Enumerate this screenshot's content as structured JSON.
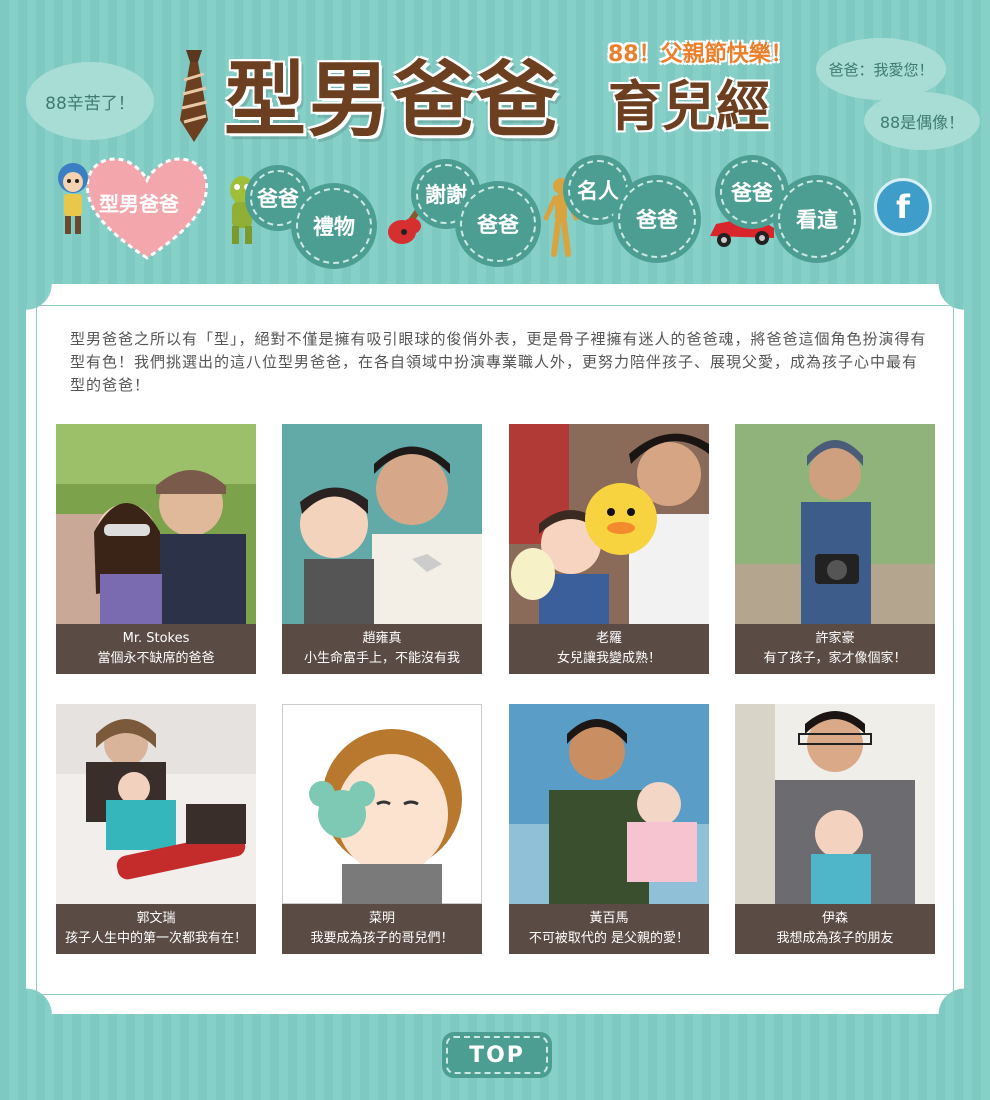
{
  "header": {
    "bubble_left": "88辛苦了！",
    "bubble_right_1": "爸爸：我愛您！",
    "bubble_right_2": "88是偶像！",
    "title_tagline": "88！父親節快樂！",
    "title_main": "型男爸爸",
    "title_sub": "育兒經",
    "colors": {
      "title": "#6b3f1f",
      "tagline": "#ec7f2c",
      "background": "#7ecac2"
    }
  },
  "nav": {
    "items": [
      {
        "label": "型男爸爸",
        "icon": "doll-figure-icon"
      },
      {
        "label_top": "爸爸",
        "label_bottom": "禮物",
        "icon": "green-toy-icon"
      },
      {
        "label_top": "謝謝",
        "label_bottom": "爸爸",
        "icon": "guitar-icon"
      },
      {
        "label_top": "名人",
        "label_bottom": "爸爸",
        "icon": "wooden-mannequin-icon"
      },
      {
        "label_top": "爸爸",
        "label_bottom": "看這",
        "icon": "red-car-icon"
      }
    ],
    "facebook": "f"
  },
  "intro": "型男爸爸之所以有「型」，絕對不僅是擁有吸引眼球的俊俏外表，更是骨子裡擁有迷人的爸爸魂，將爸爸這個角色扮演得有型有色！我們挑選出的這八位型男爸爸，在各自領域中扮演專業職人外，更努力陪伴孩子、展現父愛，成為孩子心中最有型的爸爸！",
  "dads": [
    {
      "name": "Mr. Stokes",
      "quote": "當個永不缺席的爸爸"
    },
    {
      "name": "趙雍真",
      "quote": "小生命富手上，不能沒有我"
    },
    {
      "name": "老羅",
      "quote": "女兒讓我變成熟！"
    },
    {
      "name": "許家豪",
      "quote": "有了孩子，家才像個家！"
    },
    {
      "name": "郭文瑞",
      "quote": "孩子人生中的第一次都我有在！"
    },
    {
      "name": "菜明",
      "quote": "我要成為孩子的哥兒們！"
    },
    {
      "name": "黃百馬",
      "quote": "不可被取代的 是父親的愛！"
    },
    {
      "name": "伊森",
      "quote": "我想成為孩子的朋友"
    }
  ],
  "top_button": "TOP"
}
